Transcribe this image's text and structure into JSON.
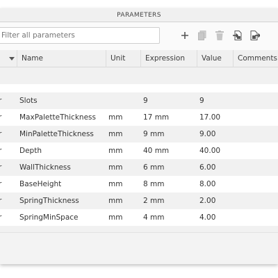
{
  "dialog": {
    "title": "PARAMETERS"
  },
  "toolbar": {
    "filter_placeholder": "Filter all parameters",
    "icons": [
      "add-icon",
      "copy-icon",
      "delete-icon",
      "import-icon",
      "export-icon"
    ]
  },
  "table": {
    "columns": {
      "name": "Name",
      "unit": "Unit",
      "expression": "Expression",
      "value": "Value",
      "comments": "Comments"
    },
    "rows": [
      {
        "type": "r",
        "name": "Slots",
        "unit": "",
        "expression": "9",
        "value": "9",
        "comments": ""
      },
      {
        "type": "r",
        "name": "MaxPaletteThickness",
        "unit": "mm",
        "expression": "17 mm",
        "value": "17.00",
        "comments": ""
      },
      {
        "type": "r",
        "name": "MinPaletteThickness",
        "unit": "mm",
        "expression": "9 mm",
        "value": "9.00",
        "comments": ""
      },
      {
        "type": "r",
        "name": "Depth",
        "unit": "mm",
        "expression": "40 mm",
        "value": "40.00",
        "comments": ""
      },
      {
        "type": "r",
        "name": "WallThickness",
        "unit": "mm",
        "expression": "6 mm",
        "value": "6.00",
        "comments": ""
      },
      {
        "type": "r",
        "name": "BaseHeight",
        "unit": "mm",
        "expression": "8 mm",
        "value": "8.00",
        "comments": ""
      },
      {
        "type": "r",
        "name": "SpringThickness",
        "unit": "mm",
        "expression": "2 mm",
        "value": "2.00",
        "comments": ""
      },
      {
        "type": "r",
        "name": "SpringMinSpace",
        "unit": "mm",
        "expression": "4 mm",
        "value": "4.00",
        "comments": ""
      }
    ]
  }
}
